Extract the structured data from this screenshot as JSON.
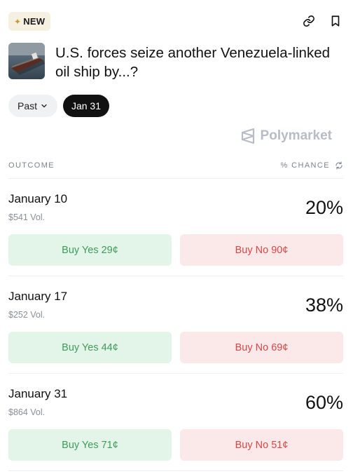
{
  "badge": {
    "label": "NEW",
    "icon": "sparkle-icon"
  },
  "actions": {
    "link_icon": "link-icon",
    "bookmark_icon": "bookmark-icon"
  },
  "market": {
    "title": "U.S. forces seize another Venezuela-linked oil ship by...?",
    "image": "oil-tanker-thumbnail"
  },
  "date_filter": {
    "past_label": "Past",
    "selected_label": "Jan 31"
  },
  "brand": {
    "name": "Polymarket"
  },
  "table": {
    "outcome_header": "OUTCOME",
    "chance_header": "% CHANCE",
    "rows": [
      {
        "date": "January 10",
        "volume": "$541 Vol.",
        "chance": "20%",
        "buy_yes": "Buy Yes 29¢",
        "buy_no": "Buy No 90¢"
      },
      {
        "date": "January 17",
        "volume": "$252 Vol.",
        "chance": "38%",
        "buy_yes": "Buy Yes 44¢",
        "buy_no": "Buy No 69¢"
      },
      {
        "date": "January 31",
        "volume": "$864 Vol.",
        "chance": "60%",
        "buy_yes": "Buy Yes 71¢",
        "buy_no": "Buy No 51¢"
      }
    ]
  },
  "colors": {
    "yes_bg": "#e3f5e8",
    "yes_text": "#3f9a5c",
    "no_bg": "#fbe9e9",
    "no_text": "#d84545",
    "badge_bg": "#f6f0e1"
  }
}
